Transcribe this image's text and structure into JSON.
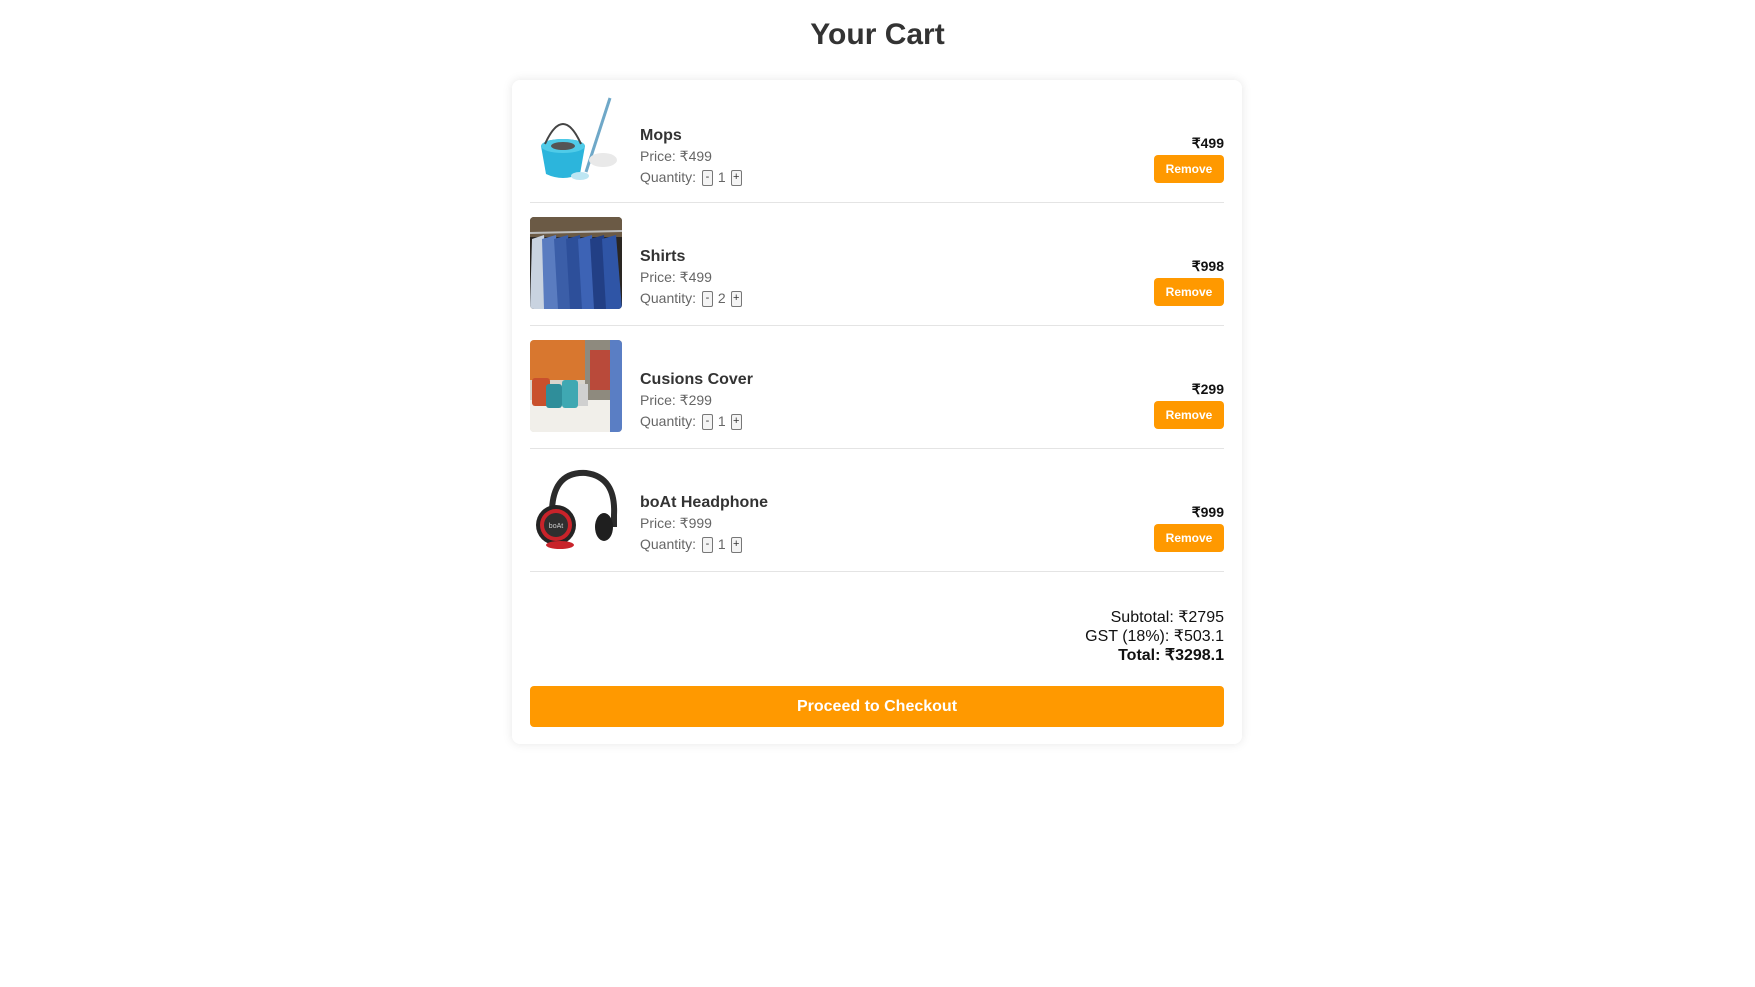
{
  "page_title": "Your Cart",
  "items": [
    {
      "name": "Mops",
      "price_label": "Price: ₹499",
      "quantity_label": "Quantity:",
      "minus": "-",
      "quantity": "1",
      "plus": "+",
      "line_total": "₹499",
      "remove_label": "Remove",
      "image": "mop-bucket-image"
    },
    {
      "name": "Shirts",
      "price_label": "Price: ₹499",
      "quantity_label": "Quantity:",
      "minus": "-",
      "quantity": "2",
      "plus": "+",
      "line_total": "₹998",
      "remove_label": "Remove",
      "image": "shirts-rack-image"
    },
    {
      "name": "Cusions Cover",
      "price_label": "Price: ₹299",
      "quantity_label": "Quantity:",
      "minus": "-",
      "quantity": "1",
      "plus": "+",
      "line_total": "₹299",
      "remove_label": "Remove",
      "image": "cushion-covers-image"
    },
    {
      "name": "boAt Headphone",
      "price_label": "Price: ₹999",
      "quantity_label": "Quantity:",
      "minus": "-",
      "quantity": "1",
      "plus": "+",
      "line_total": "₹999",
      "remove_label": "Remove",
      "image": "headphone-image"
    }
  ],
  "summary": {
    "subtotal": "Subtotal: ₹2795",
    "gst": "GST (18%): ₹503.1",
    "total": "Total: ₹3298.1"
  },
  "checkout_label": "Proceed to Checkout",
  "colors": {
    "accent": "#ff9900",
    "text": "#333333"
  }
}
